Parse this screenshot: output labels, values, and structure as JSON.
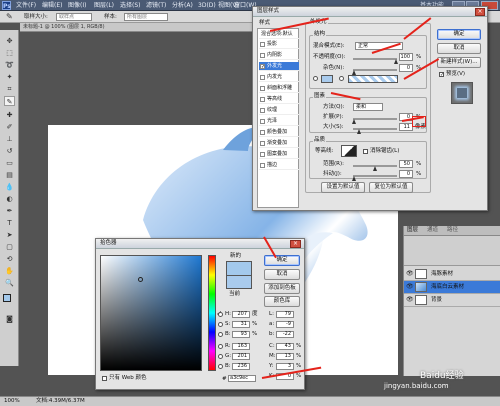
{
  "titlebar": {
    "menu": [
      "文件(F)",
      "编辑(E)",
      "图像(I)",
      "图层(L)",
      "选择(S)",
      "滤镜(T)",
      "分析(A)",
      "3D(D)",
      "视图(V)",
      "窗口(W)",
      "帮助(H)"
    ],
    "workspace_label": "基本功能"
  },
  "options_bar": {
    "mode_label": "取样大小:",
    "mode_value": "取样点",
    "sample_label": "样本:",
    "sample_value": "所有图层"
  },
  "document_tab": {
    "name": "未标题-1 @ 100% (图层 1, RGB/8)"
  },
  "layer_style_dialog": {
    "title": "图层样式",
    "styles_header": "样式",
    "blending_options": "混合选项:默认",
    "effects": [
      {
        "label": "投影",
        "checked": false
      },
      {
        "label": "内阴影",
        "checked": false
      },
      {
        "label": "外发光",
        "checked": true
      },
      {
        "label": "内发光",
        "checked": false
      },
      {
        "label": "斜面和浮雕",
        "checked": false
      },
      {
        "label": "等高线",
        "checked": false
      },
      {
        "label": "纹理",
        "checked": false
      },
      {
        "label": "光泽",
        "checked": false
      },
      {
        "label": "颜色叠加",
        "checked": false
      },
      {
        "label": "渐变叠加",
        "checked": false
      },
      {
        "label": "图案叠加",
        "checked": false
      },
      {
        "label": "描边",
        "checked": false
      }
    ],
    "outer_glow_title": "外发光",
    "structure_title": "结构",
    "blend_mode_label": "混合模式(E):",
    "blend_mode_value": "正常",
    "opacity_label": "不透明度(O):",
    "opacity_value": "100",
    "noise_label": "杂色(N):",
    "noise_value": "0",
    "elements_title": "图素",
    "technique_label": "方法(Q):",
    "technique_value": "柔和",
    "spread_label": "扩展(P):",
    "spread_value": "0",
    "size_label": "大小(S):",
    "size_value": "11",
    "size_unit": "像素",
    "quality_title": "品质",
    "contour_label": "等高线:",
    "antialias_label": "消除锯齿(L)",
    "range_label": "范围(R):",
    "range_value": "50",
    "jitter_label": "抖动(J):",
    "jitter_value": "0",
    "percent": "%",
    "set_default": "设置为默认值",
    "reset_default": "复位为默认值",
    "ok": "确定",
    "cancel": "取消",
    "new_style": "新建样式(W)...",
    "preview": "预览(V)",
    "glow_color": "#a9cbed"
  },
  "color_picker": {
    "title": "拾色器",
    "new_label": "新的",
    "current_label": "当前",
    "ok": "确定",
    "cancel": "取消",
    "add_swatch": "添加到色板",
    "color_libraries": "颜色库",
    "h_label": "H:",
    "h_value": "207",
    "h_unit": "度",
    "s_label": "S:",
    "s_value": "31",
    "s_unit": "%",
    "b_label": "B:",
    "b_value": "93",
    "b_unit": "%",
    "r_label": "R:",
    "r_value": "163",
    "g_label": "G:",
    "g_value": "201",
    "b2_label": "B:",
    "b2_value": "236",
    "l_label": "L:",
    "l_value": "79",
    "a_label": "a:",
    "a_value": "-9",
    "b3_label": "b:",
    "b3_value": "-22",
    "c_label": "C:",
    "c_value": "43",
    "c_unit": "%",
    "m_label": "M:",
    "m_value": "13",
    "m_unit": "%",
    "y_label": "Y:",
    "y_value": "3",
    "y_unit": "%",
    "k_label": "K:",
    "k_value": "0",
    "k_unit": "%",
    "web_only_label": "只有 Web 颜色",
    "hex_prefix": "#",
    "hex_value": "a3c9ec",
    "new_color": "#a3c9ec",
    "current_color": "#a9cbed"
  },
  "layers_panel": {
    "tabs": [
      "图层",
      "通道",
      "路径"
    ],
    "layers": [
      {
        "name": "海豚素材",
        "selected": false
      },
      {
        "name": "海底白云素材",
        "selected": true
      },
      {
        "name": "背景",
        "selected": false
      }
    ]
  },
  "status_bar": {
    "zoom": "100%",
    "doc_info": "文档:4.39M/6.37M"
  },
  "watermark": {
    "brand": "Baidu经验",
    "url": "jingyan.baidu.com"
  }
}
